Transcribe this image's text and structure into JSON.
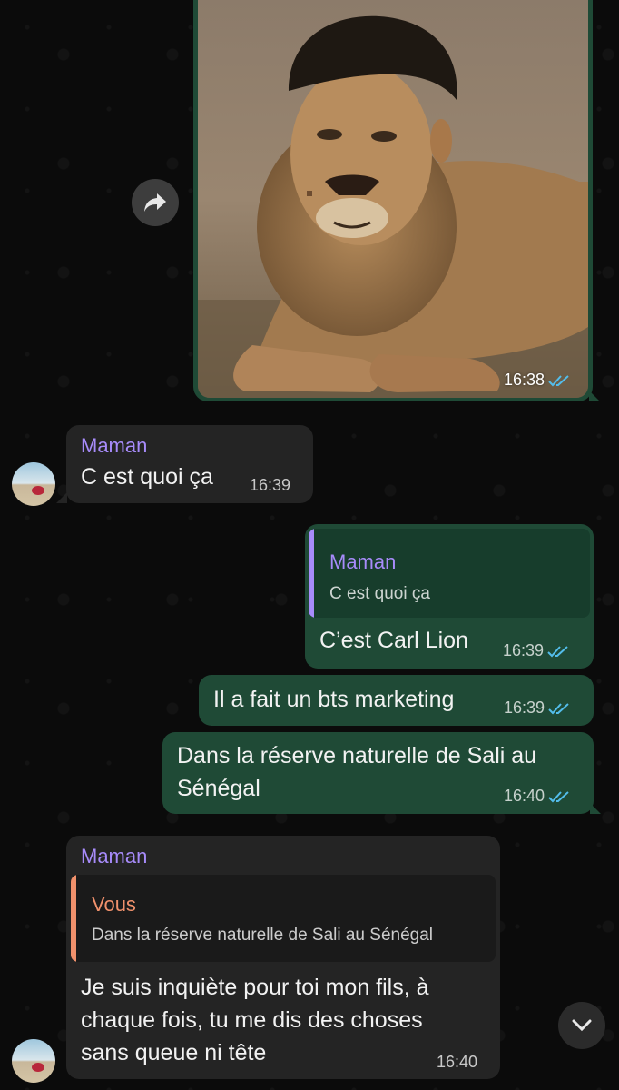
{
  "colors": {
    "outgoing_bubble": "#1f4a36",
    "incoming_bubble": "#242424",
    "sender_name": "#a78bfa",
    "reply_you": "#f0916c",
    "read_ticks": "#53bdeb"
  },
  "messages": [
    {
      "id": "m1",
      "direction": "out",
      "type": "image",
      "image_desc": "lion-with-human-face",
      "time": "16:38",
      "status_icon": "double-check-read-icon"
    },
    {
      "id": "m2",
      "direction": "in",
      "sender": "Maman",
      "text": "C est quoi ça",
      "time": "16:39"
    },
    {
      "id": "m3",
      "direction": "out",
      "reply_to": {
        "sender": "Maman",
        "text": "C est quoi ça"
      },
      "text": "C’est Carl Lion",
      "time": "16:39",
      "status_icon": "double-check-read-icon"
    },
    {
      "id": "m4",
      "direction": "out",
      "text": "Il a fait un bts marketing",
      "time": "16:39",
      "status_icon": "double-check-read-icon"
    },
    {
      "id": "m5",
      "direction": "out",
      "text_lines": [
        "Dans la réserve naturelle de Sali au",
        "Sénégal"
      ],
      "time": "16:40",
      "status_icon": "double-check-read-icon"
    },
    {
      "id": "m6",
      "direction": "in",
      "sender": "Maman",
      "reply_to": {
        "sender": "Vous",
        "text": "Dans la réserve naturelle de Sali au Sénégal"
      },
      "text_lines": [
        "Je suis inquiète pour toi mon fils, à",
        "chaque fois, tu me dis des choses",
        "sans queue ni tête"
      ],
      "time": "16:40"
    }
  ],
  "controls": {
    "forward_icon": "forward-arrow-icon",
    "scroll_down_icon": "chevron-down-icon"
  }
}
